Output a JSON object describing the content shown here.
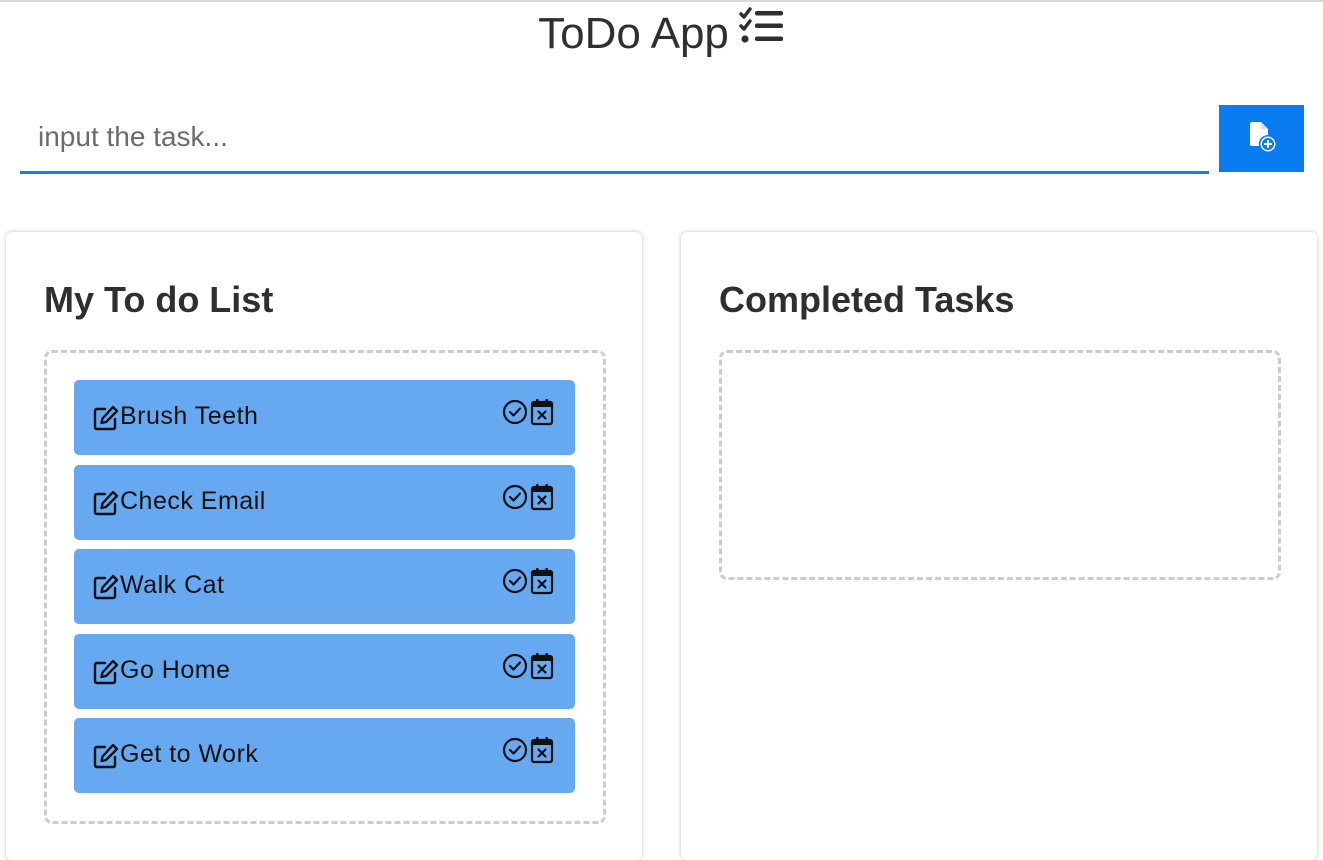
{
  "app": {
    "title": "ToDo App",
    "title_icon": "list-check-icon"
  },
  "input": {
    "placeholder": "input the task...",
    "value": ""
  },
  "add_button": {
    "icon": "file-add-icon",
    "color": "#0a7cf2"
  },
  "todo_panel": {
    "title": "My To do List",
    "tasks": [
      {
        "label": "Brush Teeth"
      },
      {
        "label": "Check Email"
      },
      {
        "label": "Walk Cat"
      },
      {
        "label": "Go Home"
      },
      {
        "label": "Get to Work"
      }
    ],
    "task_icons": [
      "edit-icon",
      "check-circle-icon",
      "calendar-x-icon"
    ],
    "task_color": "#66a9f0"
  },
  "completed_panel": {
    "title": "Completed Tasks",
    "tasks": []
  }
}
